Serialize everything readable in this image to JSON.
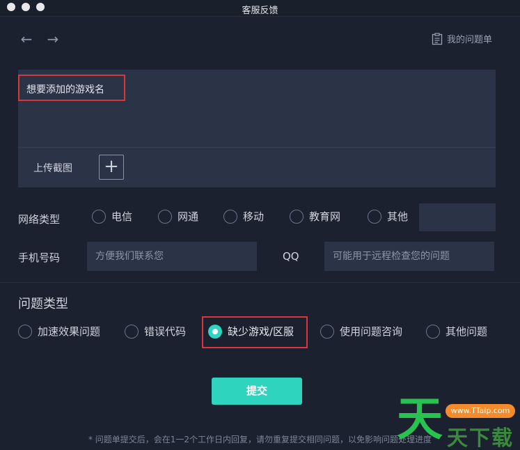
{
  "window": {
    "title": "客服反馈"
  },
  "nav": {
    "back_icon": "arrow-left-icon",
    "forward_icon": "arrow-right-icon",
    "my_issues_label": "我的问题单"
  },
  "feedback": {
    "game_name_placeholder": "想要添加的游戏名",
    "upload_label": "上传截图",
    "upload_icon": "plus-icon"
  },
  "network": {
    "label": "网络类型",
    "options": [
      "电信",
      "网通",
      "移动",
      "教育网",
      "其他"
    ],
    "selected": null
  },
  "phone": {
    "label": "手机号码",
    "placeholder": "方便我们联系您"
  },
  "qq": {
    "label": "QQ",
    "placeholder": "可能用于远程检查您的问题"
  },
  "issue_type": {
    "title": "问题类型",
    "options": [
      "加速效果问题",
      "错误代码",
      "缺少游戏/区服",
      "使用问题咨询",
      "其他问题"
    ],
    "selected": "缺少游戏/区服"
  },
  "submit_label": "提交",
  "footer_note": "* 问题单提交后，会在1一2个工作日内回复，请勿重复提交相同问题，以免影响问题处理进度",
  "watermark": {
    "big_char": "天",
    "pill_text": "www.TTaip.com",
    "small_text": "天下载"
  },
  "colors": {
    "background": "#1c2130",
    "panel": "#2b3347",
    "accent": "#2fd4bf",
    "highlight_border": "#d9353b"
  }
}
